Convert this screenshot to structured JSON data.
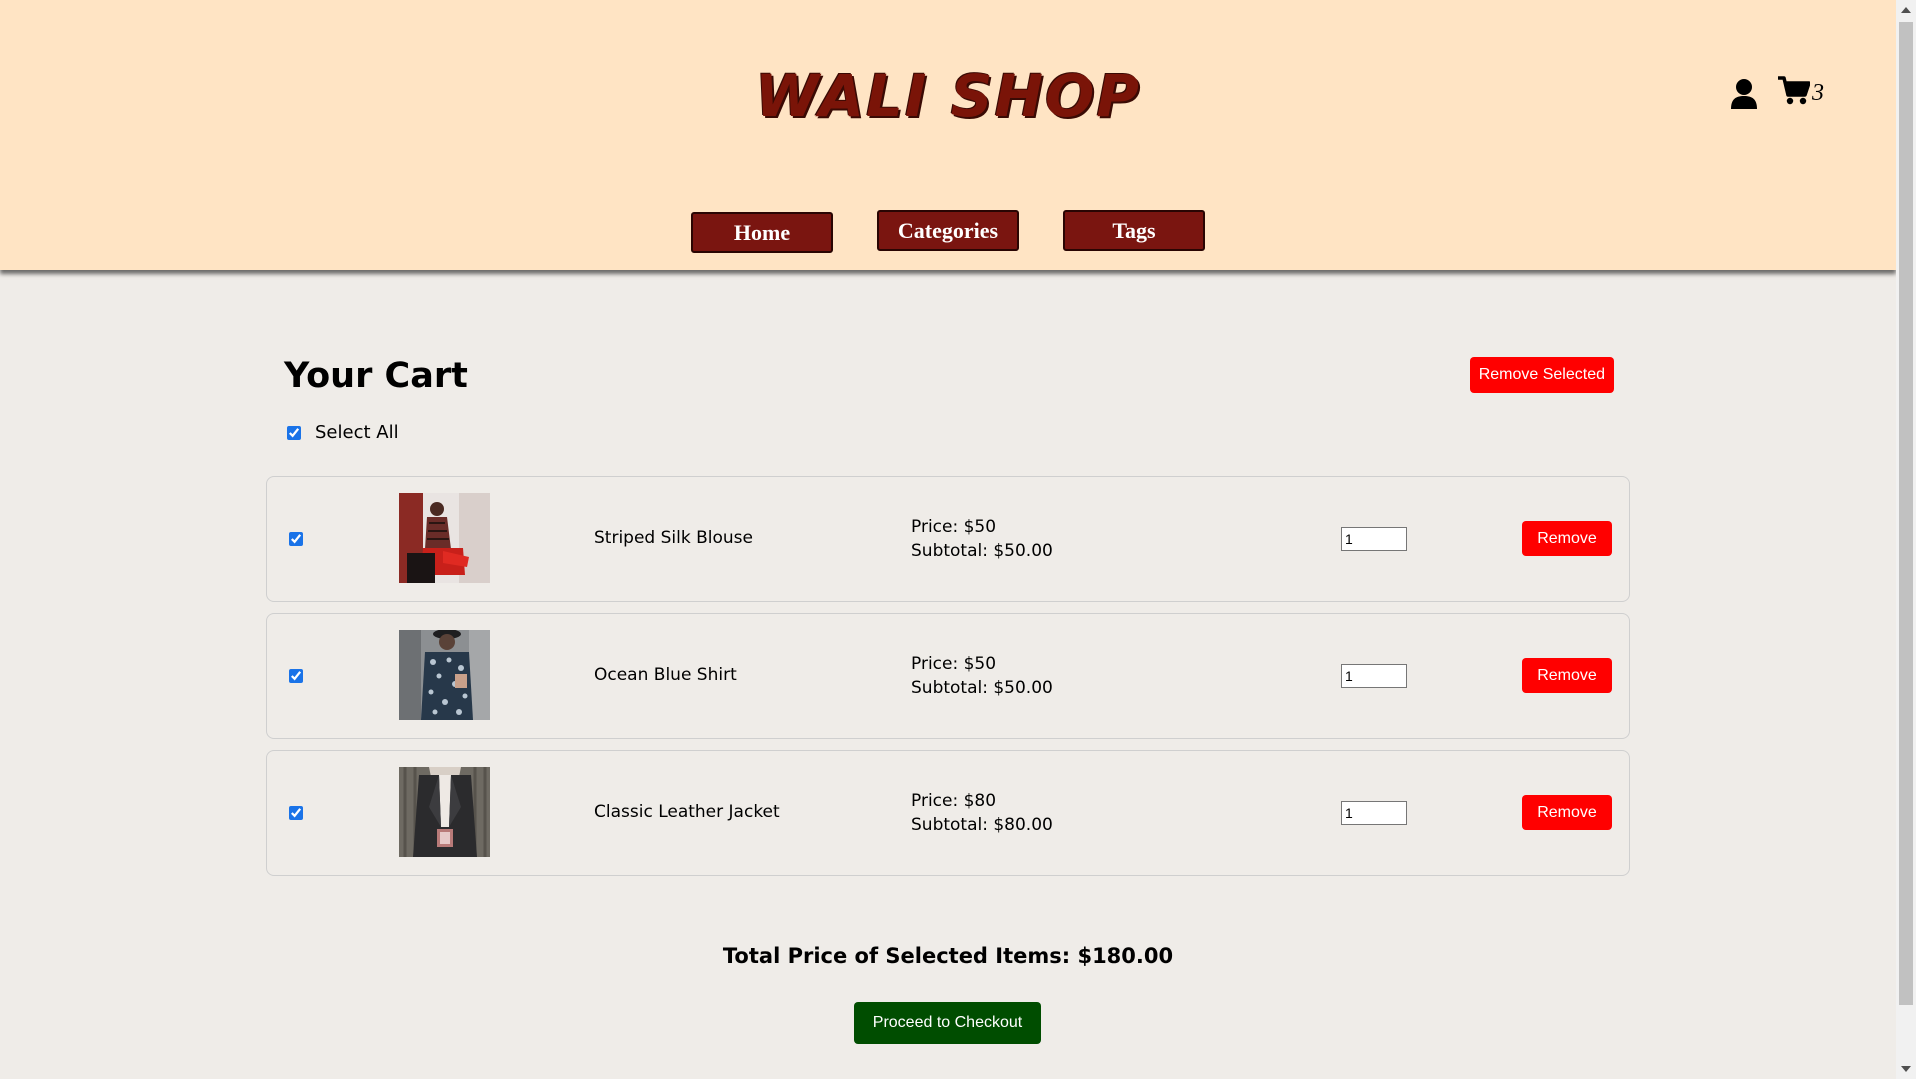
{
  "header": {
    "logo": "WALI SHOP",
    "cart_count": "3",
    "nav": [
      {
        "label": "Home"
      },
      {
        "label": "Categories"
      },
      {
        "label": "Tags"
      }
    ]
  },
  "cart": {
    "title": "Your Cart",
    "remove_selected_label": "Remove Selected",
    "select_all_label": "Select All",
    "items": [
      {
        "name": "Striped Silk Blouse",
        "price": "Price: $50",
        "subtotal": "Subtotal: $50.00",
        "quantity": "1",
        "remove_label": "Remove",
        "image": "blouse-photo"
      },
      {
        "name": "Ocean Blue Shirt",
        "price": "Price: $50",
        "subtotal": "Subtotal: $50.00",
        "quantity": "1",
        "remove_label": "Remove",
        "image": "shirt-photo"
      },
      {
        "name": "Classic Leather Jacket",
        "price": "Price: $80",
        "subtotal": "Subtotal: $80.00",
        "quantity": "1",
        "remove_label": "Remove",
        "image": "jacket-photo"
      }
    ],
    "total": "Total Price of Selected Items: $180.00",
    "checkout_label": "Proceed to Checkout"
  },
  "colors": {
    "header_bg": "#ffe4c4",
    "brand": "#7a1408",
    "danger": "#ff0000",
    "checkout": "#004d00"
  },
  "icons": [
    "user-icon",
    "cart-icon"
  ]
}
